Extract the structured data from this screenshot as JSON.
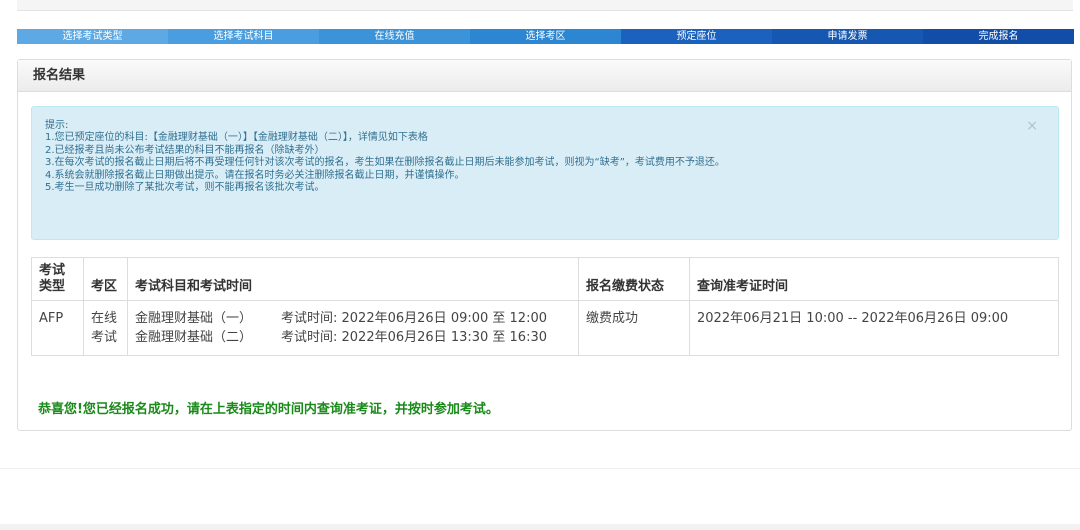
{
  "steps": [
    "选择考试类型",
    "选择考试科目",
    "在线充值",
    "选择考区",
    "预定座位",
    "申请发票",
    "完成报名"
  ],
  "panel": {
    "title": "报名结果"
  },
  "alert": {
    "close": "×",
    "lines": [
      "提示:",
      "1.您已预定座位的科目:【金融理财基础（一）】【金融理财基础（二）】，详情见如下表格",
      "2.已经报考且尚未公布考试结果的科目不能再报名（除缺考外）",
      "3.在每次考试的报名截止日期后将不再受理任何针对该次考试的报名，考生如果在删除报名截止日期后未能参加考试，则视为“缺考”，考试费用不予退还。",
      "4.系统会就删除报名截止日期做出提示。请在报名时务必关注删除报名截止日期，并谨慎操作。",
      "5.考生一旦成功删除了某批次考试，则不能再报名该批次考试。"
    ]
  },
  "table": {
    "headers": [
      "考试类型",
      "考区",
      "考试科目和考试时间",
      "报名缴费状态",
      "查询准考证时间"
    ],
    "row": {
      "exam_type": "AFP",
      "area": "在线考试",
      "subjects": [
        {
          "name": "金融理财基础（一）",
          "time": "考试时间:  2022年06月26日 09:00 至 12:00"
        },
        {
          "name": "金融理财基础（二）",
          "time": "考试时间:  2022年06月26日 13:30 至 16:30"
        }
      ],
      "status": "缴费成功",
      "admission_time": "2022年06月21日 10:00 -- 2022年06月26日 09:00"
    }
  },
  "success_message": "恭喜您!您已经报名成功，请在上表指定的时间内查询准考证，并按时参加考试。"
}
